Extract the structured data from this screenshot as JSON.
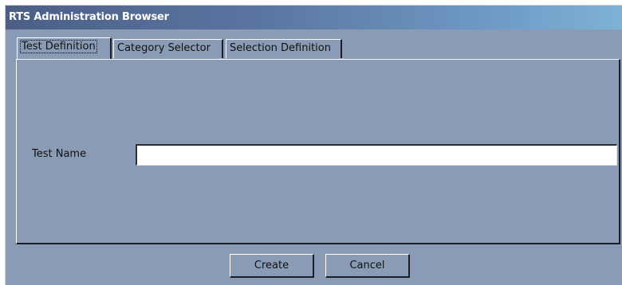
{
  "window": {
    "title": "RTS Administration Browser"
  },
  "tabs": [
    {
      "label": "Test Definition",
      "active": true
    },
    {
      "label": "Category Selector",
      "active": false
    },
    {
      "label": "Selection Definition",
      "active": false
    }
  ],
  "form": {
    "test_name_label": "Test Name",
    "test_name_value": "",
    "test_name_placeholder": ""
  },
  "buttons": {
    "create_label": "Create",
    "cancel_label": "Cancel"
  },
  "colors": {
    "window_bg": "#8a9cb5",
    "titlebar_start": "#4b5f86",
    "titlebar_end": "#7fb2d8",
    "title_text": "#ffffff"
  }
}
